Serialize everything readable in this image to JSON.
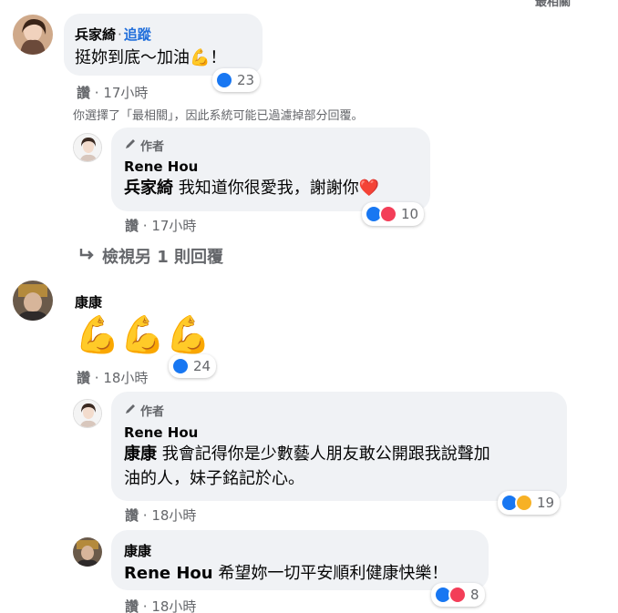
{
  "top_cut_text": "最相關",
  "comments": {
    "c1": {
      "name": "兵家綺",
      "separator": "·",
      "follow": "追蹤",
      "text": "挺妳到底～加油💪！",
      "reaction_count": "23",
      "like": "讚",
      "time": "17小時",
      "filter_note": "你選擇了「最相關」，因此系統可能已過濾掉部分回覆。"
    },
    "r1": {
      "badge": "作者",
      "name": "Rene Hou",
      "mention": "兵家綺",
      "text": " 我知道你很愛我，謝謝你❤️",
      "reaction_count": "10",
      "like": "讚",
      "time": "17小時"
    },
    "view_more": "檢視另 1 則回覆",
    "c2": {
      "name": "康康",
      "text": "💪💪💪",
      "reaction_count": "24",
      "like": "讚",
      "time": "18小時"
    },
    "r2": {
      "badge": "作者",
      "name": "Rene Hou",
      "mention": "康康",
      "text_line1": " 我會記得你是少數藝人朋友敢公開跟我說聲加",
      "text_line2": "油的人，妹子銘記於心。",
      "reaction_count": "19",
      "like": "讚",
      "time": "18小時"
    },
    "r3": {
      "name": "康康",
      "mention": "Rene Hou",
      "text": " 希望妳一切平安順利健康快樂！",
      "reaction_count": "8",
      "like": "讚",
      "time": "18小時"
    }
  },
  "colors": {
    "bubble": "#f0f2f5",
    "like": "#1877f2",
    "love": "#f33e58",
    "care": "#f7b125",
    "meta": "#65676b",
    "follow": "#216fdb"
  },
  "icons": [
    "avatar-bing-icon",
    "avatar-rene-icon",
    "avatar-kangkang-icon",
    "pen-icon",
    "like-icon",
    "love-icon",
    "care-icon",
    "reply-arrow-icon"
  ]
}
